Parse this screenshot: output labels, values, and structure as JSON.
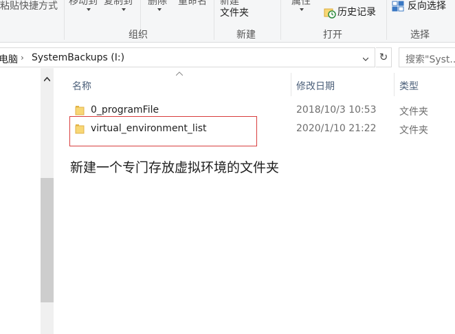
{
  "ribbon": {
    "paste_shortcut": "粘贴快捷方式",
    "move_to": "移动到",
    "copy_to": "复制到",
    "delete": "删除",
    "rename": "重命名",
    "new_folder_line1": "新建",
    "new_folder_line2": "文件夹",
    "properties": "属性",
    "history": "历史记录",
    "invert_selection": "反向选择",
    "groups": {
      "organize": "组织",
      "new": "新建",
      "open": "打开",
      "select": "选择"
    }
  },
  "address": {
    "prefix": "电脑",
    "path": "SystemBackups (I:)"
  },
  "search": {
    "placeholder": "搜索\"Syst..."
  },
  "columns": {
    "name": "名称",
    "modified": "修改日期",
    "type": "类型"
  },
  "files": [
    {
      "name": "0_programFile",
      "modified": "2018/10/3 10:53",
      "type": "文件夹"
    },
    {
      "name": "virtual_environment_list",
      "modified": "2020/1/10 21:22",
      "type": "文件夹"
    }
  ],
  "caption": "新建一个专门存放虚拟环境的文件夹",
  "colors": {
    "highlight_box": "#d83b3b",
    "folder": "#f8d775",
    "header_text": "#4c607a"
  },
  "icons": [
    "folder-icon",
    "history-icon",
    "invert-selection-icon",
    "refresh-icon",
    "chevron-right-icon",
    "chevron-down-icon",
    "chevron-up-icon"
  ]
}
